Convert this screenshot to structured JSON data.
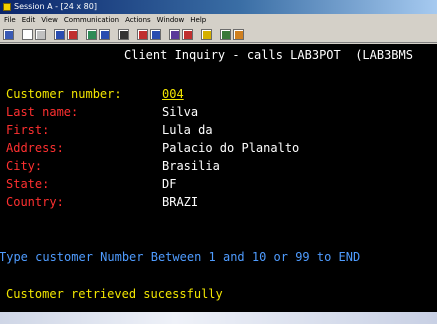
{
  "window": {
    "title": "Session A - [24 x 80]"
  },
  "menu": [
    "File",
    "Edit",
    "View",
    "Communication",
    "Actions",
    "Window",
    "Help"
  ],
  "toolbar": {
    "icons": [
      "print-icon",
      "copy-icon",
      "paste-icon",
      "send-icon",
      "receive-icon",
      "display-icon",
      "keyboard-icon",
      "macro-icon",
      "record-icon",
      "play-icon",
      "quick-key-icon",
      "color-icon",
      "help-icon"
    ]
  },
  "terminal": {
    "header": "Client Inquiry - calls LAB3POT  (LAB3BMS",
    "fields": [
      {
        "label": "Customer number:",
        "value": "004"
      },
      {
        "label": "Last name:",
        "value": "Silva"
      },
      {
        "label": "First:",
        "value": "Lula da"
      },
      {
        "label": "Address:",
        "value": "Palacio do Planalto"
      },
      {
        "label": "City:",
        "value": "Brasilia"
      },
      {
        "label": "State:",
        "value": "DF"
      },
      {
        "label": "Country:",
        "value": "BRAZI"
      }
    ],
    "prompt": "Type customer Number Between 1 and 10 or 99 to END",
    "status": "Customer retrieved sucessfully"
  },
  "colors": {
    "label_first": "#f2e600",
    "label_other": "#ff3030",
    "value": "#ffffff",
    "prompt": "#4f9cff",
    "status": "#f2e600"
  }
}
